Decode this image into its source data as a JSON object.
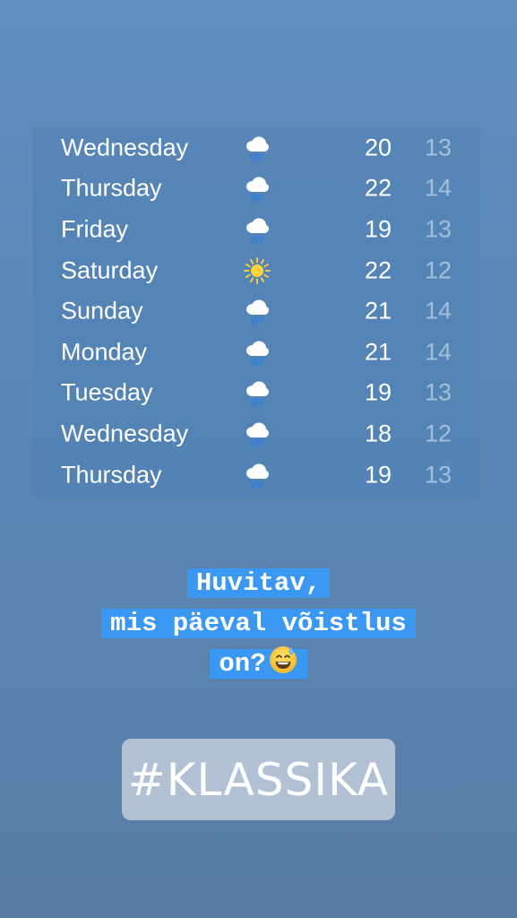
{
  "forecast": {
    "rows": [
      {
        "day": "Wednesday",
        "icon": "rain-cloud-icon",
        "high": "20",
        "low": "13"
      },
      {
        "day": "Thursday",
        "icon": "rain-cloud-icon",
        "high": "22",
        "low": "14"
      },
      {
        "day": "Friday",
        "icon": "rain-cloud-icon",
        "high": "19",
        "low": "13"
      },
      {
        "day": "Saturday",
        "icon": "sun-icon",
        "high": "22",
        "low": "12"
      },
      {
        "day": "Sunday",
        "icon": "rain-cloud-icon",
        "high": "21",
        "low": "14"
      },
      {
        "day": "Monday",
        "icon": "rain-cloud-icon",
        "high": "21",
        "low": "14"
      },
      {
        "day": "Tuesday",
        "icon": "rain-cloud-icon",
        "high": "19",
        "low": "13"
      },
      {
        "day": "Wednesday",
        "icon": "rain-cloud-icon",
        "high": "18",
        "low": "12"
      },
      {
        "day": "Thursday",
        "icon": "rain-cloud-icon",
        "high": "19",
        "low": "13"
      }
    ]
  },
  "caption": {
    "line1": "Huvitav,",
    "line2": "mis päeval võistlus",
    "line3": "on?",
    "emoji": "grinning-face-with-sweat-icon"
  },
  "hashtag": {
    "text": "#KLASSIKA"
  },
  "colors": {
    "caption_highlight": "#3a97f2",
    "low_temp": "rgba(255,255,255,0.48)",
    "rain_drops": "#2f7fe0",
    "sun": "#ffd43b"
  }
}
